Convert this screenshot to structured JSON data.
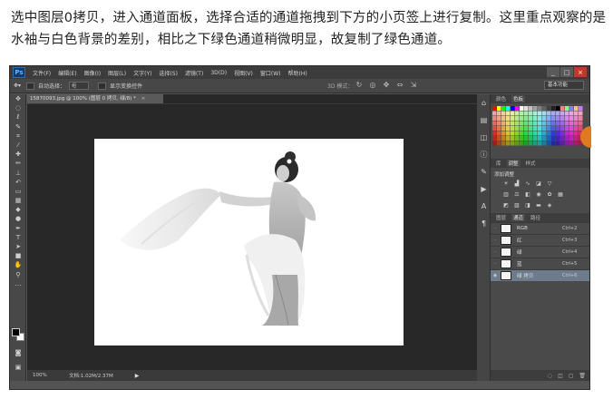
{
  "caption": "选中图层0拷贝，进入通道面板，选择合适的通道拖拽到下方的小页签上进行复制。这里重点观察的是水袖与白色背景的差别，相比之下绿色通道稍微明显，故复制了绿色通道。",
  "app": {
    "logo": "Ps",
    "menus": [
      "文件(F)",
      "编辑(E)",
      "图像(I)",
      "图层(L)",
      "文字(Y)",
      "选择(S)",
      "滤镜(T)",
      "3D(D)",
      "视图(V)",
      "窗口(W)",
      "帮助(H)"
    ],
    "window_buttons": [
      "_",
      "□",
      "×"
    ]
  },
  "options_bar": {
    "auto_select_label": "自动选择：",
    "auto_select_value": "组",
    "show_transform_label": "显示变换控件",
    "mode_3d": "3D 模式：",
    "workspace": "基本功能"
  },
  "document": {
    "tab_title": "15870093.jpg @ 100% (图层 0 拷贝, 绿/8) *",
    "tab_close": "×",
    "zoom": "100%",
    "doc_info": "文档:1.02M/2.37M",
    "status_arrow": "▶"
  },
  "tools": [
    "move-icon",
    "marquee-icon",
    "lasso-icon",
    "quick-select-icon",
    "crop-icon",
    "eyedropper-icon",
    "healing-icon",
    "brush-icon",
    "stamp-icon",
    "history-brush-icon",
    "eraser-icon",
    "gradient-icon",
    "blur-icon",
    "dodge-icon",
    "pen-icon",
    "type-icon",
    "path-select-icon",
    "shape-icon",
    "hand-icon",
    "zoom-icon"
  ],
  "panels": {
    "color_tabs": [
      "颜色",
      "色板"
    ],
    "adjust_tabs": [
      "库",
      "调整",
      "样式"
    ],
    "adjust_title": "添加调整",
    "layer_tabs": [
      "图层",
      "通道",
      "路径"
    ],
    "channels": [
      {
        "name": "RGB",
        "key": "Ctrl+2"
      },
      {
        "name": "红",
        "key": "Ctrl+3"
      },
      {
        "name": "绿",
        "key": "Ctrl+4"
      },
      {
        "name": "蓝",
        "key": "Ctrl+5"
      },
      {
        "name": "绿 拷贝",
        "key": "Ctrl+6"
      }
    ],
    "selected_channel_index": 4
  },
  "colors": {
    "ui_dark": "#535353",
    "selected_row": "#6d7b8c",
    "close_red": "#c0392b",
    "accent_orange": "#e07a22"
  }
}
